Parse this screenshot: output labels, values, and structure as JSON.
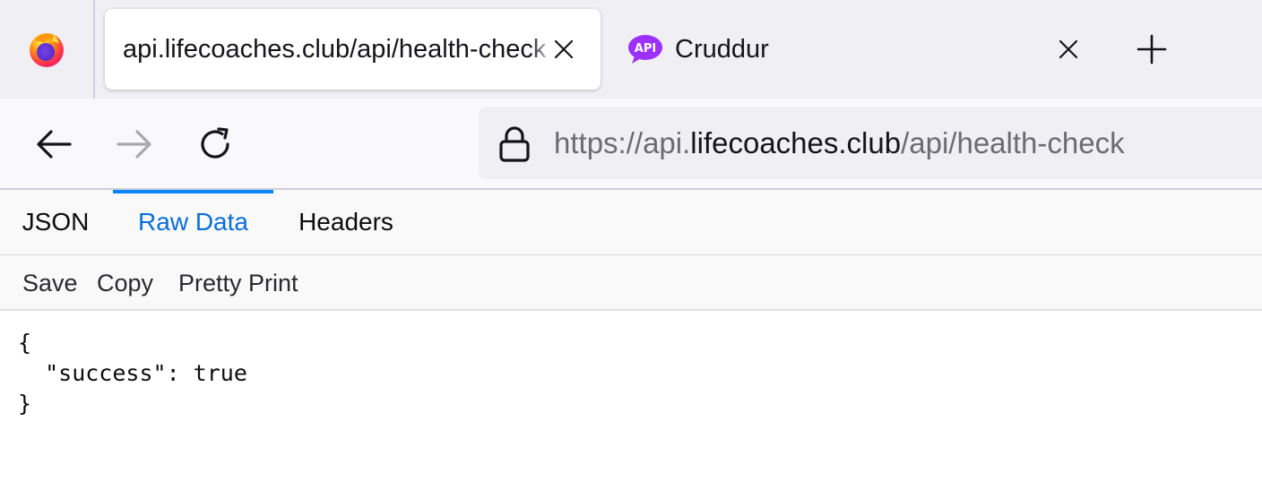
{
  "browser": {
    "tabs": [
      {
        "title": "api.lifecoaches.club/api/health-check",
        "selected": true,
        "close_icon": "close-icon"
      },
      {
        "title": "Cruddur",
        "selected": false,
        "favicon": "api-chat-bubble-icon",
        "close_icon": "close-icon"
      }
    ],
    "new_tab_icon": "plus-icon",
    "firefox_icon": "firefox-icon"
  },
  "navbar": {
    "back_icon": "back-arrow-icon",
    "forward_icon": "forward-arrow-icon",
    "reload_icon": "reload-icon",
    "lock_icon": "lock-icon",
    "url": {
      "scheme": "https://",
      "subdomain": "api.",
      "domain": "lifecoaches.club",
      "path": "/api/health-check"
    }
  },
  "viewer": {
    "tabs": [
      {
        "label": "JSON",
        "active": false
      },
      {
        "label": "Raw Data",
        "active": true
      },
      {
        "label": "Headers",
        "active": false
      }
    ],
    "toolbar": {
      "save_label": "Save",
      "copy_label": "Copy",
      "pretty_print_label": "Pretty Print"
    },
    "raw_content": "{\n  \"success\": true\n}"
  },
  "colors": {
    "tabstrip_bg": "#f0f0f4",
    "active_tab_text": "#0a6fd6",
    "active_tab_indicator": "#0a84ff",
    "cruddur_favicon": "#8a2be2"
  }
}
